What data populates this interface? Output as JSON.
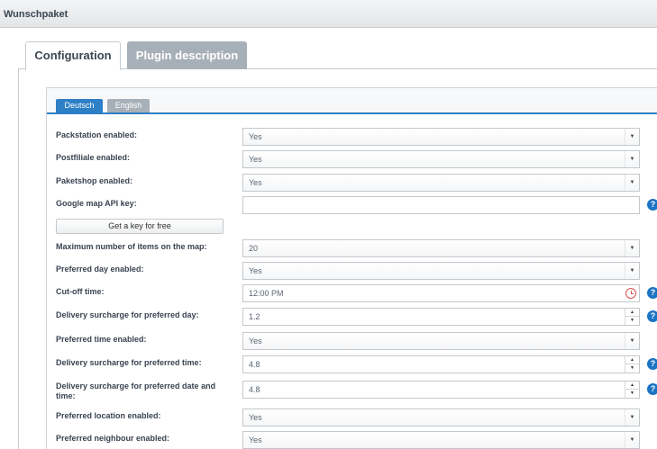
{
  "window": {
    "title": "Wunschpaket"
  },
  "main_tabs": [
    {
      "label": "Configuration",
      "active": true
    },
    {
      "label": "Plugin description",
      "active": false
    }
  ],
  "language_tabs": [
    {
      "label": "Deutsch",
      "active": true
    },
    {
      "label": "English",
      "active": false
    }
  ],
  "form": {
    "packstation": {
      "label": "Packstation enabled:",
      "value": "Yes"
    },
    "postfiliale": {
      "label": "Postfiliale enabled:",
      "value": "Yes"
    },
    "paketshop": {
      "label": "Paketshop enabled:",
      "value": "Yes"
    },
    "api_key": {
      "label": "Google map API key:",
      "value": "",
      "help": "?"
    },
    "key_button": {
      "label": "Get a key for free"
    },
    "max_items": {
      "label": "Maximum number of items on the map:",
      "value": "20"
    },
    "preferred_day": {
      "label": "Preferred day enabled:",
      "value": "Yes"
    },
    "cutoff_time": {
      "label": "Cut-off time:",
      "value": "12:00 PM",
      "help": "?"
    },
    "surcharge_day": {
      "label": "Delivery surcharge for preferred day:",
      "value": "1.2",
      "help": "?"
    },
    "preferred_time": {
      "label": "Preferred time enabled:",
      "value": "Yes"
    },
    "surcharge_time": {
      "label": "Delivery surcharge for preferred time:",
      "value": "4.8",
      "help": "?"
    },
    "surcharge_date_time": {
      "label": "Delivery surcharge for preferred date and time:",
      "value": "4.8",
      "help": "?"
    },
    "preferred_location": {
      "label": "Preferred location enabled:",
      "value": "Yes"
    },
    "preferred_neighbour": {
      "label": "Preferred neighbour enabled:",
      "value": "Yes"
    }
  },
  "icons": {
    "dropdown": "caret-down-icon",
    "spinner": "spinner-arrows-icon",
    "time": "clock-icon",
    "help": "help-icon"
  },
  "colors": {
    "accent": "#2d7fc6",
    "inactive_tab": "#a7b0b8",
    "help_badge": "#1b74c4",
    "clock_icon": "#d9534f"
  }
}
